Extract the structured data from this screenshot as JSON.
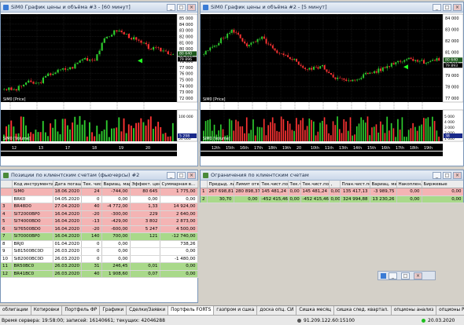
{
  "chart1": {
    "title": "SiM0 График цены и объёма #3 - [60 минут]",
    "price_label": "SiM0 [Price]",
    "volume_label": "SiM0 [Volume]",
    "price_ticks": [
      "85 000",
      "84 000",
      "83 000",
      "82 000",
      "81 000",
      "80 000",
      "79 000",
      "78 000",
      "77 000",
      "76 000",
      "75 000",
      "74 000",
      "73 000",
      "72 000"
    ],
    "x_ticks": [
      "12",
      "13",
      "17",
      "18",
      "19",
      "20"
    ],
    "vol_ticks": [
      "100 000",
      "50 000"
    ],
    "last_price": "80 640",
    "last_price2": "79 896",
    "last_volume": "5 298"
  },
  "chart2": {
    "title": "SiM0 График цены и объёма #2 - [5 минут]",
    "price_label": "SiM0 [Price]",
    "volume_label": "SiM0 [Volume]",
    "price_ticks": [
      "84 000",
      "83 000",
      "82 000",
      "81 000",
      "80 000",
      "79 000",
      "78 000",
      "77 000"
    ],
    "x_ticks": [
      "12th",
      "15th",
      "16th",
      "17th",
      "18th",
      "19th",
      "20",
      "10th",
      "11th",
      "13th",
      "14th",
      "15th",
      "16th",
      "17th",
      "18th",
      "19th"
    ],
    "x_ticks_top": [
      "10th",
      "12th",
      "14th",
      "15th",
      "16th",
      "17th",
      "18th",
      "19th"
    ],
    "date_label": "20",
    "vol_ticks": [
      "5 000",
      "4 000",
      "3 000",
      "2 000",
      "1 000"
    ],
    "last_price": "80 640",
    "last_price2": "79 893",
    "last_volume": "38"
  },
  "positions": {
    "title": "Позиции по клиентским счетам (фьючерсы) #2",
    "columns": [
      "Код инструмента",
      "Дата погашения",
      "Тек. чист. поз.",
      "Вариац. маржа",
      "Эффект. цена",
      "Суммарная в..."
    ],
    "rows": [
      {
        "n": "",
        "code": "SiM0",
        "date": "18.06.2020",
        "pos": "24",
        "vm": "-744,00",
        "price": "80 645",
        "sum": "1 775,00",
        "style": "red"
      },
      {
        "n": "",
        "code": "BRK0",
        "date": "04.05.2020",
        "pos": "0",
        "vm": "0,00",
        "price": "0,00",
        "sum": "0,00",
        "style": "white"
      },
      {
        "n": "3",
        "code": "BR48D0",
        "date": "27.04.2020",
        "pos": "40",
        "vm": "-4 772,00",
        "price": "1,33",
        "sum": "14 924,00",
        "style": "red"
      },
      {
        "n": "4",
        "code": "SI72000BP0",
        "date": "16.04.2020",
        "pos": "-20",
        "vm": "-300,00",
        "price": "229",
        "sum": "2 640,00",
        "style": "red"
      },
      {
        "n": "5",
        "code": "SI74000BD0",
        "date": "16.04.2020",
        "pos": "-13",
        "vm": "-429,00",
        "price": "3 802",
        "sum": "2 873,00",
        "style": "red"
      },
      {
        "n": "6",
        "code": "SI76500BD0",
        "date": "16.04.2020",
        "pos": "-20",
        "vm": "-600,00",
        "price": "5 247",
        "sum": "4 500,00",
        "style": "red"
      },
      {
        "n": "7",
        "code": "SI70000BP0",
        "date": "16.04.2020",
        "pos": "140",
        "vm": "700,00",
        "price": "121",
        "sum": "-12 740,00",
        "style": "green"
      },
      {
        "n": "8",
        "code": "BRJ0",
        "date": "01.04.2020",
        "pos": "0",
        "vm": "0,00",
        "price": "",
        "sum": "738,26",
        "style": "white"
      },
      {
        "n": "9",
        "code": "Si81500BC0D",
        "date": "26.03.2020",
        "pos": "0",
        "vm": "0,00",
        "price": "",
        "sum": "0,00",
        "style": "white"
      },
      {
        "n": "10",
        "code": "Si82000BC0D",
        "date": "26.03.2020",
        "pos": "0",
        "vm": "0,00",
        "price": "",
        "sum": "-1 480,00",
        "style": "white"
      },
      {
        "n": "11",
        "code": "BR50BC0",
        "date": "26.03.2020",
        "pos": "31",
        "vm": "246,45",
        "price": "0,01",
        "sum": "0,00",
        "style": "green"
      },
      {
        "n": "12",
        "code": "BR41BC0",
        "date": "26.03.2020",
        "pos": "40",
        "vm": "1 908,60",
        "price": "0,07",
        "sum": "0,00",
        "style": "green"
      }
    ]
  },
  "limits": {
    "title": "Ограничения по клиентским счетам",
    "columns": [
      "",
      "Предыд. лимит",
      "Лимит откр. п",
      "Тек.чист.поз.",
      "Тек.чист.",
      "Тек.чист.поз. (",
      ",",
      "План.чист.поз.",
      "Вариац. маржа",
      "Накоплен. д.",
      "Биржевые"
    ],
    "rows": [
      {
        "cells": [
          "1",
          "267 698,81",
          "280 898,37",
          "145 481,24",
          "0,00",
          "145 481,24",
          "0,00",
          "135 417,13",
          "-3 989,75",
          "0,00",
          "0,00"
        ],
        "style": "red"
      },
      {
        "cells": [
          "2",
          "30,70",
          "0,00",
          "-452 415,46",
          "0,00",
          "-452 415,46",
          "0,00",
          "324 994,88",
          "13 230,26",
          "0,00",
          "0,00"
        ],
        "style": "green"
      }
    ]
  },
  "tabs": [
    "облигации",
    "Котировки",
    "Портфель ФР",
    "Графики",
    "Сделки/Заявки",
    "Портфель FORTS",
    "газпром и сшка",
    "доска опц. СИ",
    "Сишка месяц",
    "сишка след. квартал.",
    "опционы анализ",
    "опционы РТС",
    "нефть-"
  ],
  "active_tab": "Портфель FORTS",
  "status": {
    "server_time": "Время сервера: 19:58:00; записей: 16140661; текущих: 42046288",
    "ip": "91.209.122.60:15100",
    "date": "20.03.2020"
  },
  "colors": {
    "bull": "#2ecc2e",
    "bear": "#ff3333",
    "chart_bg": "#000000",
    "grid": "#3c3c3c"
  }
}
